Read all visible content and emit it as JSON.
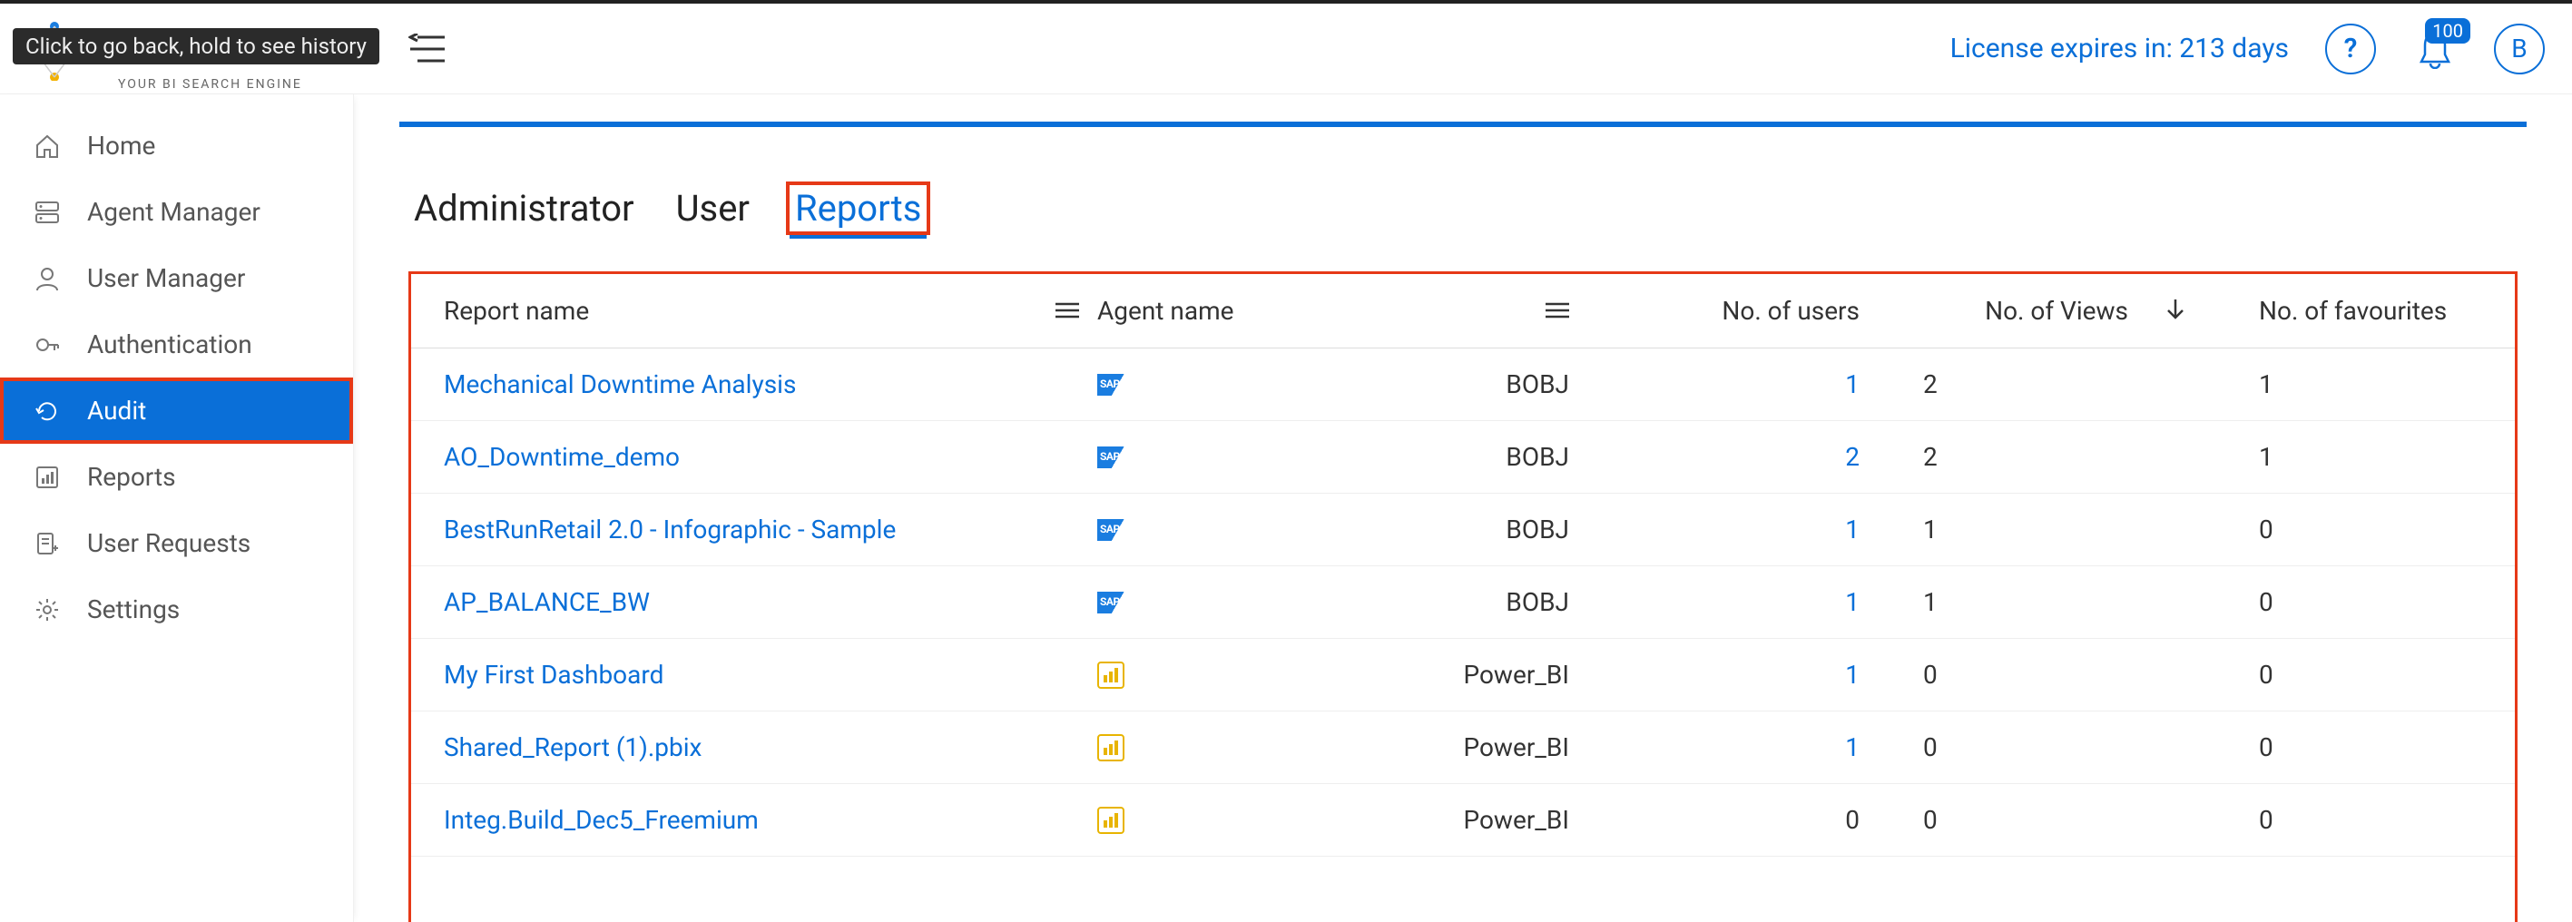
{
  "tooltip": "Click to go back, hold to see history",
  "logo_sub": "YOUR BI SEARCH ENGINE",
  "header": {
    "license_text": "License expires in: 213 days",
    "notification_count": "100",
    "avatar_initial": "B"
  },
  "sidebar": {
    "items": [
      {
        "label": "Home",
        "icon": "home",
        "active": false
      },
      {
        "label": "Agent Manager",
        "icon": "server",
        "active": false
      },
      {
        "label": "User Manager",
        "icon": "user",
        "active": false
      },
      {
        "label": "Authentication",
        "icon": "key",
        "active": false
      },
      {
        "label": "Audit",
        "icon": "refresh",
        "active": true
      },
      {
        "label": "Reports",
        "icon": "chart",
        "active": false
      },
      {
        "label": "User Requests",
        "icon": "request",
        "active": false
      },
      {
        "label": "Settings",
        "icon": "gear",
        "active": false
      }
    ]
  },
  "tabs": [
    {
      "label": "Administrator",
      "active": false
    },
    {
      "label": "User",
      "active": false
    },
    {
      "label": "Reports",
      "active": true
    }
  ],
  "table": {
    "columns": {
      "report": "Report name",
      "agent": "Agent name",
      "users": "No. of users",
      "views": "No. of Views",
      "fav": "No. of favourites"
    },
    "rows": [
      {
        "report": "Mechanical Downtime Analysis",
        "agent": "BOBJ",
        "agent_type": "sap",
        "users": "1",
        "views": "2",
        "fav": "1"
      },
      {
        "report": "AO_Downtime_demo",
        "agent": "BOBJ",
        "agent_type": "sap",
        "users": "2",
        "views": "2",
        "fav": "1"
      },
      {
        "report": "BestRunRetail 2.0 - Infographic - Sample",
        "agent": "BOBJ",
        "agent_type": "sap",
        "users": "1",
        "views": "1",
        "fav": "0"
      },
      {
        "report": "AP_BALANCE_BW",
        "agent": "BOBJ",
        "agent_type": "sap",
        "users": "1",
        "views": "1",
        "fav": "0"
      },
      {
        "report": "My First Dashboard",
        "agent": "Power_BI",
        "agent_type": "pbi",
        "users": "1",
        "views": "0",
        "fav": "0"
      },
      {
        "report": "Shared_Report (1).pbix",
        "agent": "Power_BI",
        "agent_type": "pbi",
        "users": "1",
        "views": "0",
        "fav": "0"
      },
      {
        "report": "Integ.Build_Dec5_Freemium",
        "agent": "Power_BI",
        "agent_type": "pbi",
        "users": "0",
        "views": "0",
        "fav": "0"
      }
    ]
  }
}
